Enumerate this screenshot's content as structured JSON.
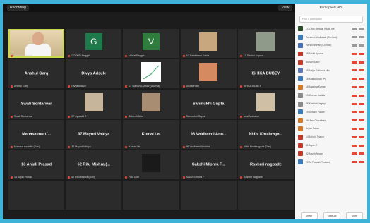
{
  "topbar": {
    "recording": "Recording",
    "view": "View"
  },
  "panel": {
    "title": "Participants (80)",
    "search_placeholder": "Find a participant",
    "participants": [
      {
        "name": "COORD Regglal (Host, me)",
        "color": "#2a4d2a"
      },
      {
        "name": "Ganaesh Wolkalale (Co-host)",
        "color": "#3d7ab8"
      },
      {
        "name": "Harshvardhan (Co-host)",
        "color": "#4b6fb0"
      },
      {
        "name": "05 Abdul Apurva",
        "color": "#c0392b"
      },
      {
        "name": "Ashvini Dalvi",
        "color": "#c0392b"
      },
      {
        "name": "09 Aniya Gaikwad Hiru",
        "color": "#5c7bb8"
      },
      {
        "name": "15 Kalika Shah (P)",
        "color": "#3d7ab8"
      },
      {
        "name": "16 Agastya Kumar",
        "color": "#d17a2b"
      },
      {
        "name": "19 Chetan Hadkar",
        "color": "#8a8a8a"
      },
      {
        "name": "79 Kashish Jagtap",
        "color": "#8a8a8a"
      },
      {
        "name": "19 Shivani Parate",
        "color": "#3d7ab8"
      },
      {
        "name": "Hill Bav Chaudhary",
        "color": "#d17a2b"
      },
      {
        "name": "Aryan Pawar",
        "color": "#d17a2b"
      },
      {
        "name": "14 Ashvin Thakur",
        "color": "#c0392b"
      },
      {
        "name": "31 Aryan T",
        "color": "#c0392b"
      },
      {
        "name": "32 Ayush Negre",
        "color": "#c0392b"
      },
      {
        "name": "20 Af Prakash Thakare",
        "color": "#3d7ab8"
      }
    ],
    "invite": "Invite",
    "mute_all": "Mute All",
    "more": "More"
  },
  "tiles": [
    {
      "type": "video",
      "label": "COORD Reggal",
      "active": true
    },
    {
      "type": "letter",
      "letter": "G",
      "color": "#1e7a4a",
      "label": "COORD Reggal"
    },
    {
      "type": "letter",
      "letter": "V",
      "color": "#2f7d3d",
      "label": "Vainal Reggie"
    },
    {
      "type": "photo",
      "color": "#c8a77e",
      "label": "10 Sambhava Dakre"
    },
    {
      "type": "photo",
      "color": "#8f9a8a",
      "label": "10 Sadhvi Kapoor"
    },
    {
      "type": "name",
      "name": "Anshul Garg",
      "label": "Anshul Garg"
    },
    {
      "type": "name",
      "name": "Divya Adsule",
      "label": "Divya Adsule"
    },
    {
      "type": "chart",
      "label": "07 Gavisha Adhav (Apurva)"
    },
    {
      "type": "photo",
      "color": "#d68a60",
      "label": "Disha Patel"
    },
    {
      "type": "name",
      "name": "ISHIKA DUBEY",
      "label": "ISHIKA DUBEY"
    },
    {
      "type": "name",
      "name": "Swati Sontarwar",
      "label": "Swati Sontarwar"
    },
    {
      "type": "photo",
      "color": "#c7b59b",
      "label": "27 Jiyanshi T"
    },
    {
      "type": "photo",
      "color": "#a88d72",
      "label": "Jidnesh Alice"
    },
    {
      "type": "name",
      "name": "Sanmukhi Gupta",
      "label": "Sanmukhi Gupta"
    },
    {
      "type": "photo",
      "color": "#cfc0a5",
      "label": "Ishvi Mahakar"
    },
    {
      "type": "name",
      "name": "Manasa  mortf...",
      "label": "Manasa moretfiv (Dan)"
    },
    {
      "type": "name",
      "name": "37 Mayuri Valdya",
      "label": "37 Mayuri Valdya"
    },
    {
      "type": "name",
      "name": "Komal Lal",
      "label": "Komal Lal"
    },
    {
      "type": "name",
      "name": "96 Vaidhavni  Ano...",
      "label": "96 Vaidhavni Anokhe"
    },
    {
      "type": "name",
      "name": "Nidhi  Kholbraga...",
      "label": "Nidhi Kholbragade (Dan)"
    },
    {
      "type": "name",
      "name": "13 Anjali Prasad",
      "label": "13 Anjali Prasad"
    },
    {
      "type": "name",
      "name": "62 Ritu  Mishra (...",
      "label": "62 Ritu Mishra (Dan)"
    },
    {
      "type": "photo",
      "color": "#1a1a1a",
      "label": "Ritu Goel"
    },
    {
      "type": "name",
      "name": "Sakshi  Mishra  F...",
      "label": "Sakshi Mishra F"
    },
    {
      "type": "name",
      "name": "Rashmi nagpade",
      "label": "Rashmi nagpade"
    },
    {
      "type": "empty"
    },
    {
      "type": "empty"
    },
    {
      "type": "empty"
    },
    {
      "type": "empty"
    },
    {
      "type": "empty"
    }
  ]
}
